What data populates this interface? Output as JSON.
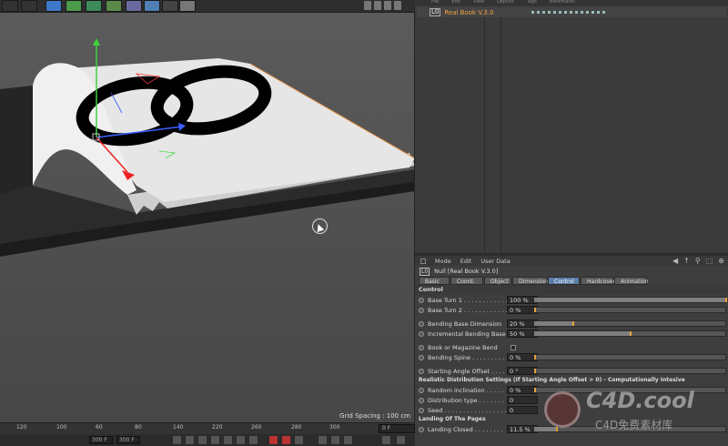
{
  "viewport": {
    "grid_spacing": "Grid Spacing : 100 cm"
  },
  "timeline": {
    "ticks": [
      "120",
      "100",
      "60",
      "80",
      "140",
      "120",
      "220",
      "200",
      "260",
      "280",
      "300"
    ],
    "frame": "0 F",
    "field_left": "300 F",
    "field_right": "300 F"
  },
  "object_manager": {
    "menu": [
      "File",
      "Edit",
      "View",
      "Objects",
      "Tags",
      "Bookmarks"
    ],
    "object_icon": "L0",
    "object_name": "Real Book V.3.0"
  },
  "attributes": {
    "menu": [
      "Mode",
      "Edit",
      "User Data"
    ],
    "object_icon": "L0",
    "title": "Null [Real Book V.3.0]",
    "tabs": [
      "Basic",
      "Coord.",
      "Object",
      "Dimension",
      "Control",
      "Hardcover",
      "Animation"
    ],
    "active_tab": "Control",
    "section_control": "Control",
    "params": [
      {
        "label": "Base Turn 1 . . . . . . . . . . . .",
        "value": "100 %",
        "fill": 1.0
      },
      {
        "label": "Base Turn 2 . . . . . . . . . . . .",
        "value": "0 %",
        "fill": 0.0
      },
      {
        "label": "Bending Base Dimension",
        "value": "20 %",
        "fill": 0.2
      },
      {
        "label": "Incremental Bending Base",
        "value": "50 %",
        "fill": 0.5
      },
      {
        "label": "Book or Magazine Bend",
        "value": "",
        "fill": null
      },
      {
        "label": "Bending Spine . . . . . . . . . . .",
        "value": "0 %",
        "fill": 0.0
      },
      {
        "label": "Starting Angle Offset . . . .",
        "value": "0 °",
        "fill": 0.0
      }
    ],
    "section_realistic": "Realistic Distribution Settings (If Starting Angle Offset > 0) - Computationally Intesive",
    "params2": [
      {
        "label": "Random inclination . . . . .",
        "value": "0 %",
        "fill": 0.0
      },
      {
        "label": "Distribution type . . . . . . .",
        "value": "0",
        "fill": null
      },
      {
        "label": "Seed . . . . . . . . . . . . . . . . .",
        "value": "0",
        "fill": null
      }
    ],
    "section_landing": "Landing Of The Pages",
    "params3": [
      {
        "label": "Landing Closed . . . . . . . .",
        "value": "11.5 %",
        "fill": 0.115
      }
    ]
  },
  "watermark": {
    "text": "C4D.cool",
    "sub": "C4D免费素材库"
  },
  "colors": {
    "accent": "#5b7fa8",
    "highlight": "#e8a23a",
    "object_name": "#f3a243"
  }
}
